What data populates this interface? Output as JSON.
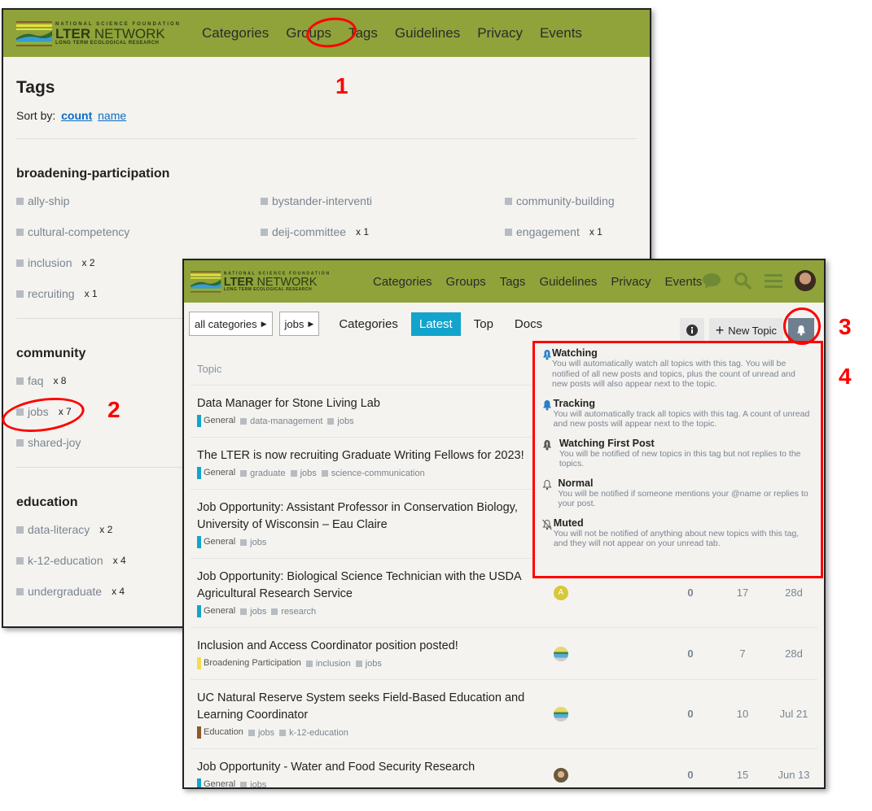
{
  "logo": {
    "top": "NATIONAL SCIENCE FOUNDATION",
    "name_bold": "LTER",
    "name": "NETWORK",
    "sub": "LONG TERM ECOLOGICAL RESEARCH"
  },
  "nav": [
    "Categories",
    "Groups",
    "Tags",
    "Guidelines",
    "Privacy",
    "Events"
  ],
  "tags_page": {
    "title": "Tags",
    "sort_label": "Sort by:",
    "sort_count": "count",
    "sort_name": "name",
    "sections": [
      {
        "name": "broadening-participation",
        "tags": [
          {
            "name": "ally-ship",
            "count": ""
          },
          {
            "name": "bystander-interventi",
            "count": ""
          },
          {
            "name": "community-building",
            "count": ""
          },
          {
            "name": "cultural-competency",
            "count": ""
          },
          {
            "name": "deij-committee",
            "count": "x 1"
          },
          {
            "name": "engagement",
            "count": "x 1"
          },
          {
            "name": "inclusion",
            "count": "x 2"
          },
          {
            "name": "recruiting",
            "count": "x 1"
          }
        ]
      },
      {
        "name": "community",
        "tags": [
          {
            "name": "faq",
            "count": "x 8"
          },
          {
            "name": "jobs",
            "count": "x 7"
          },
          {
            "name": "shared-joy",
            "count": ""
          }
        ]
      },
      {
        "name": "education",
        "tags": [
          {
            "name": "data-literacy",
            "count": "x 2"
          },
          {
            "name": "k-12-education",
            "count": "x 4"
          },
          {
            "name": "undergraduate",
            "count": "x 4"
          }
        ]
      }
    ]
  },
  "topic_list": {
    "category_dropdown": "all categories",
    "tag_dropdown": "jobs",
    "tabs": [
      "Categories",
      "Latest",
      "Top",
      "Docs"
    ],
    "active_tab": "Latest",
    "new_topic": "New Topic",
    "column_topic": "Topic",
    "rows": [
      {
        "title": "Data Manager for Stone Living Lab",
        "category": "General",
        "cat_color": "#12a4cc",
        "tags": [
          "data-management",
          "jobs"
        ],
        "avatar": "",
        "replies": "",
        "views": "",
        "activity": ""
      },
      {
        "title": "The LTER is now recruiting Graduate Writing Fellows for 2023!",
        "category": "General",
        "cat_color": "#12a4cc",
        "tags": [
          "graduate",
          "jobs",
          "science-communication"
        ],
        "avatar": "",
        "replies": "",
        "views": "",
        "activity": ""
      },
      {
        "title": "Job Opportunity: Assistant Professor in Conservation Biology, University of Wisconsin – Eau Claire",
        "category": "General",
        "cat_color": "#12a4cc",
        "tags": [
          "jobs"
        ],
        "avatar": "",
        "replies": "",
        "views": "",
        "activity": ""
      },
      {
        "title": "Job Opportunity: Biological Science Technician with the USDA Agricultural Research Service",
        "category": "General",
        "cat_color": "#12a4cc",
        "tags": [
          "jobs",
          "research"
        ],
        "avatar": "A",
        "replies": "0",
        "views": "17",
        "activity": "28d"
      },
      {
        "title": "Inclusion and Access Coordinator position posted!",
        "category": "Broadening Participation",
        "cat_color": "#f5dc4c",
        "tags": [
          "inclusion",
          "jobs"
        ],
        "avatar": "lter",
        "replies": "0",
        "views": "7",
        "activity": "28d"
      },
      {
        "title": "UC Natural Reserve System seeks Field-Based Education and Learning Coordinator",
        "category": "Education",
        "cat_color": "#8b5a2b",
        "tags": [
          "jobs",
          "k-12-education"
        ],
        "avatar": "lter",
        "replies": "0",
        "views": "10",
        "activity": "Jul 21"
      },
      {
        "title": "Job Opportunity - Water and Food Security Research",
        "category": "General",
        "cat_color": "#12a4cc",
        "tags": [
          "jobs"
        ],
        "avatar": "photo",
        "replies": "0",
        "views": "15",
        "activity": "Jun 13"
      }
    ]
  },
  "notification_menu": [
    {
      "label": "Watching",
      "icon": "bell-exclamation-icon",
      "color": "#2a7fc9",
      "desc": "You will automatically watch all topics with this tag. You will be notified of all new posts and topics, plus the count of unread and new posts will also appear next to the topic."
    },
    {
      "label": "Tracking",
      "icon": "bell-icon",
      "color": "#2a7fc9",
      "desc": "You will automatically track all topics with this tag. A count of unread and new posts will appear next to the topic."
    },
    {
      "label": "Watching First Post",
      "icon": "bell-exclamation-icon",
      "color": "#555555",
      "desc": "You will be notified of new topics in this tag but not replies to the topics."
    },
    {
      "label": "Normal",
      "icon": "bell-outline-icon",
      "color": "#555555",
      "desc": "You will be notified if someone mentions your @name or replies to your post."
    },
    {
      "label": "Muted",
      "icon": "bell-slash-icon",
      "color": "#555555",
      "desc": "You will not be notified of anything about new topics with this tag, and they will not appear on your unread tab."
    }
  ],
  "annotations": [
    "1",
    "2",
    "3",
    "4"
  ],
  "colors": {
    "header": "#8fa33a",
    "accent": "#12a4cc",
    "annotation": "#ff0000"
  }
}
